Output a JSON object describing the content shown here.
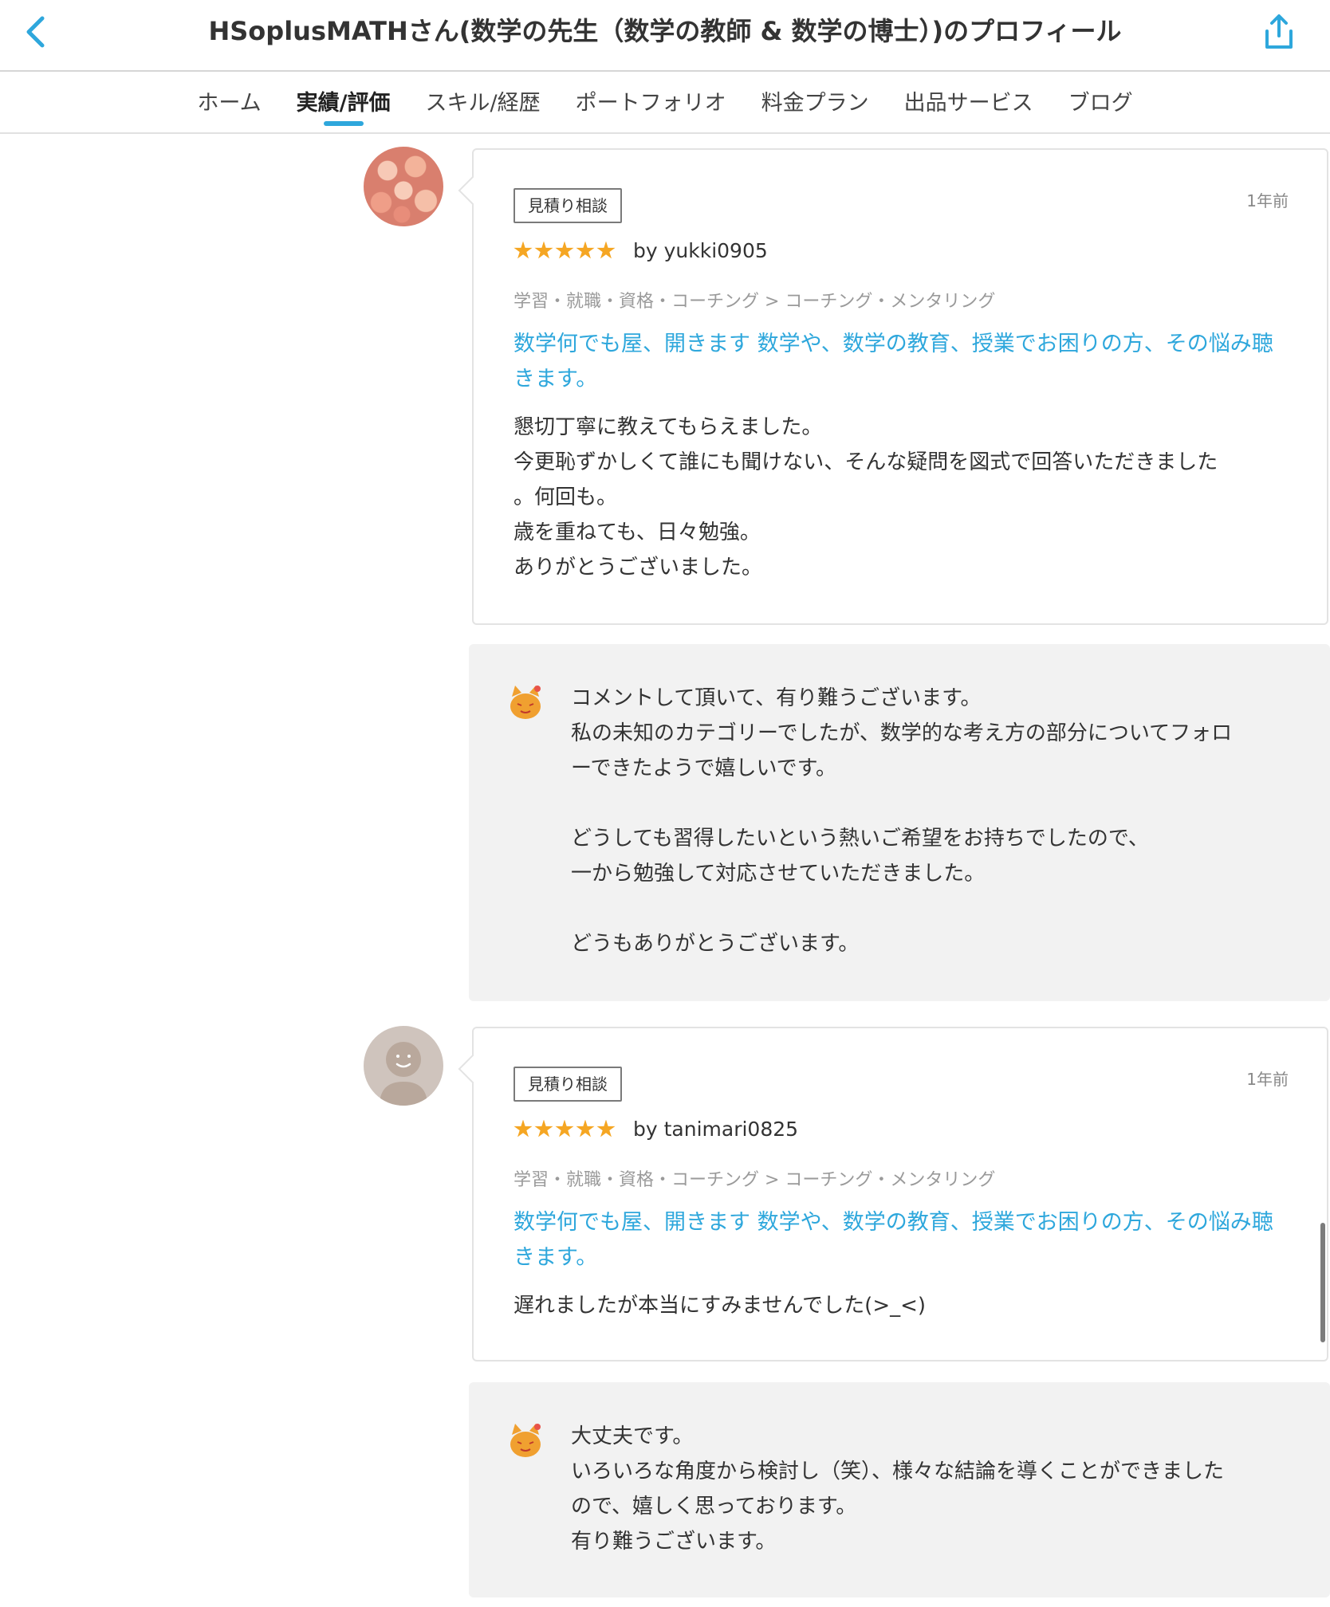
{
  "header": {
    "title": "HSoplusMATHさん(数学の先生（数学の教師 & 数学の博士）)のプロフィール",
    "back_icon": "chevron-left-icon",
    "share_icon": "share-icon",
    "accent_color": "#2ea7dc"
  },
  "tabs": [
    {
      "label": "ホーム",
      "active": false
    },
    {
      "label": "実績/評価",
      "active": true
    },
    {
      "label": "スキル/経歴",
      "active": false
    },
    {
      "label": "ポートフォリオ",
      "active": false
    },
    {
      "label": "料金プラン",
      "active": false
    },
    {
      "label": "出品サービス",
      "active": false
    },
    {
      "label": "ブログ",
      "active": false
    }
  ],
  "reviews": [
    {
      "badge": "見積り相談",
      "time": "1年前",
      "rating": 5,
      "by": "by yukki0905",
      "category": "学習・就職・資格・コーチング > コーチング・メンタリング",
      "service": "数学何でも屋、開きます 数学や、数学の教育、授業でお困りの方、その悩み聴きます。",
      "text": "懇切丁寧に教えてもらえました。\n今更恥ずかしくて誰にも聞けない、そんな疑問を図式で回答いただきました\n。何回も。\n歳を重ねても、日々勉強。\nありがとうございました。",
      "reply": "コメントして頂いて、有り難うございます。\n私の未知のカテゴリーでしたが、数学的な考え方の部分についてフォロ\nーできたようで嬉しいです。\n\nどうしても習得したいという熱いご希望をお持ちでしたので、\n一から勉強して対応させていただきました。\n\nどうもありがとうございます。"
    },
    {
      "badge": "見積り相談",
      "time": "1年前",
      "rating": 5,
      "by": "by tanimari0825",
      "category": "学習・就職・資格・コーチング > コーチング・メンタリング",
      "service": "数学何でも屋、開きます 数学や、数学の教育、授業でお困りの方、その悩み聴きます。",
      "text": "遅れましたが本当にすみませんでした(>_<)",
      "reply": "大丈夫です。\nいろいろな角度から検討し（笑）、様々な結論を導くことができました\nので、嬉しく思っております。\n有り難うございます。"
    }
  ],
  "colors": {
    "star": "#f5a623",
    "link": "#2ea7dc",
    "reply_bg": "#f2f2f2"
  }
}
